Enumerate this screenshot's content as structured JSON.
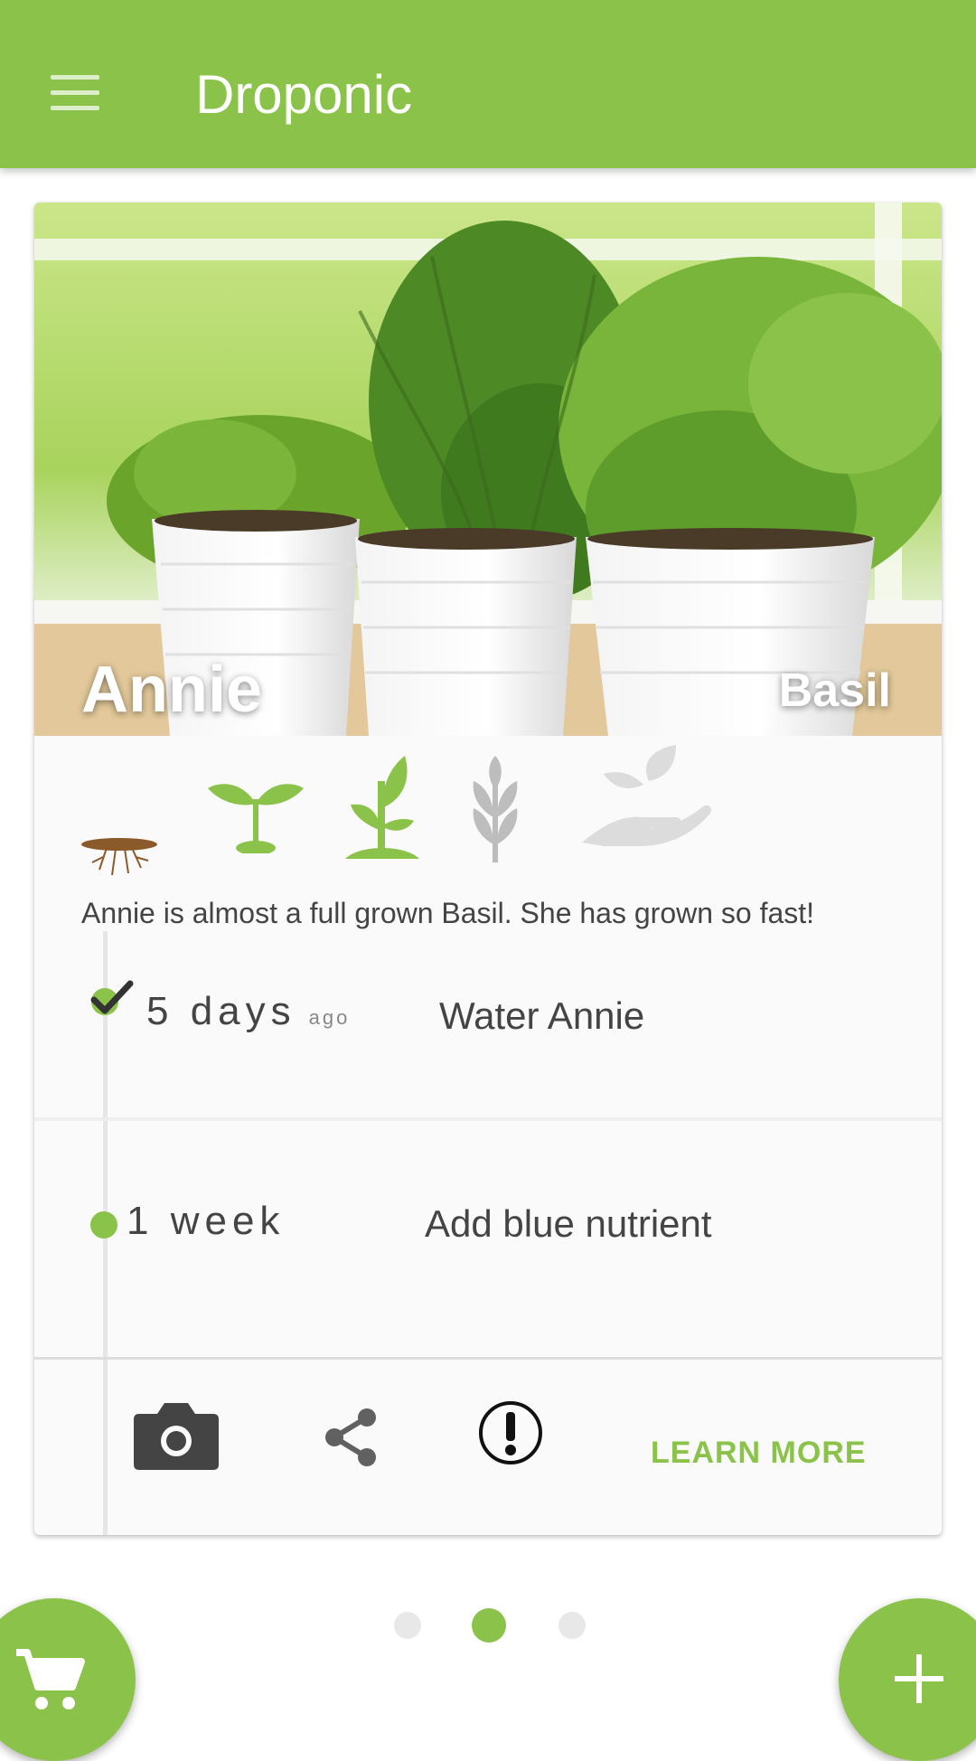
{
  "app": {
    "title": "Droponic"
  },
  "colors": {
    "accent": "#8bc34a",
    "text": "#444444",
    "inactive": "#bdbdbd"
  },
  "plant": {
    "name": "Annie",
    "type": "Basil"
  },
  "stages": [
    {
      "icon": "roots-icon",
      "state": "done"
    },
    {
      "icon": "sprout-icon",
      "state": "done"
    },
    {
      "icon": "seedling-icon",
      "state": "current"
    },
    {
      "icon": "grown-plant-icon",
      "state": "future"
    },
    {
      "icon": "harvest-hand-icon",
      "state": "future"
    }
  ],
  "description": "Annie is almost a full grown Basil. She has grown so fast!",
  "tasks": [
    {
      "when": "5 days",
      "suffix": "ago",
      "title": "Water Annie",
      "status": "done"
    },
    {
      "when": "1 week",
      "title": "Add blue nutrient",
      "status": "upcoming"
    }
  ],
  "actions": {
    "learn_more": "LEARN MORE"
  },
  "pager": {
    "count": 3,
    "active": 2
  }
}
